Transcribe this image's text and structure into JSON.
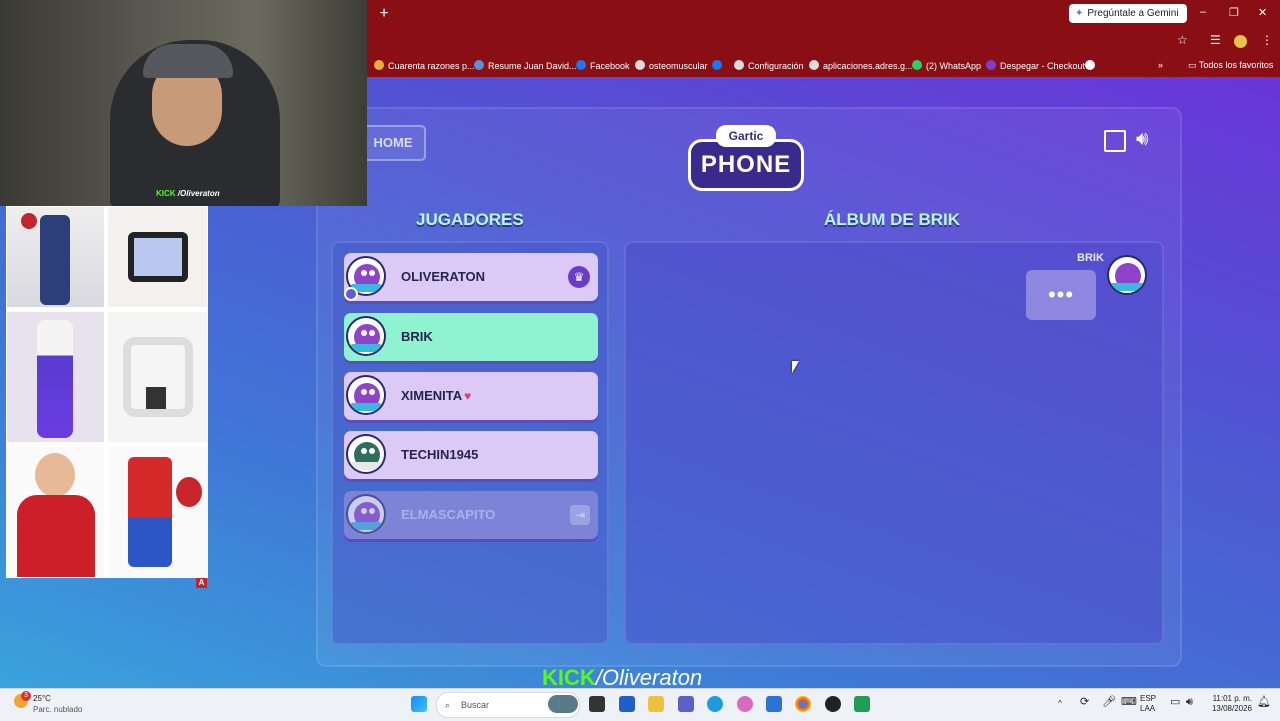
{
  "browser": {
    "new_tab": "+",
    "gemini_label": "Pregúntale a Gemini",
    "window_controls": [
      "–",
      "❐",
      "✕"
    ],
    "bookmarks": [
      {
        "label": "Cuarenta razones p..."
      },
      {
        "label": "Resume Juan David..."
      },
      {
        "label": "Facebook"
      },
      {
        "label": "osteomuscular"
      },
      {
        "label": ""
      },
      {
        "label": "Configuración"
      },
      {
        "label": "aplicaciones.adres.g..."
      },
      {
        "label": "(2) WhatsApp"
      },
      {
        "label": "Despegar - Checkout"
      }
    ],
    "all_favorites": "Todos los favoritos",
    "more_chevron": "»"
  },
  "game": {
    "home_label": "HOME",
    "logo_top": "Gartic",
    "logo_main": "PHONE",
    "players_title": "JUGADORES",
    "album_title": "ÁLBUM DE BRIK",
    "players": [
      {
        "name": "OLIVERATON",
        "state": "host"
      },
      {
        "name": "BRIK",
        "state": "active"
      },
      {
        "name": "XIMENITA",
        "state": "normal"
      },
      {
        "name": "TECHIN1945",
        "state": "normal"
      },
      {
        "name": "ELMASCAPITO",
        "state": "left"
      }
    ],
    "heart": "♥",
    "chat": {
      "author": "BRIK",
      "bubble_text": "•••"
    },
    "accent": "#8ff2d0"
  },
  "stream": {
    "cam_tag_kick": "KICK",
    "cam_tag_handle": "/Oliveraton",
    "overlay_kick": "KICK",
    "overlay_handle": "/Oliveraton",
    "grid_mark": "A"
  },
  "taskbar": {
    "weather_temp": "25°C",
    "weather_desc": "Parc. nublado",
    "weather_badge": "3",
    "search_placeholder": "Buscar",
    "lang_top": "ESP",
    "lang_bottom": "LAA",
    "time": "11:01 p. m.",
    "date": "13/08/2026"
  }
}
